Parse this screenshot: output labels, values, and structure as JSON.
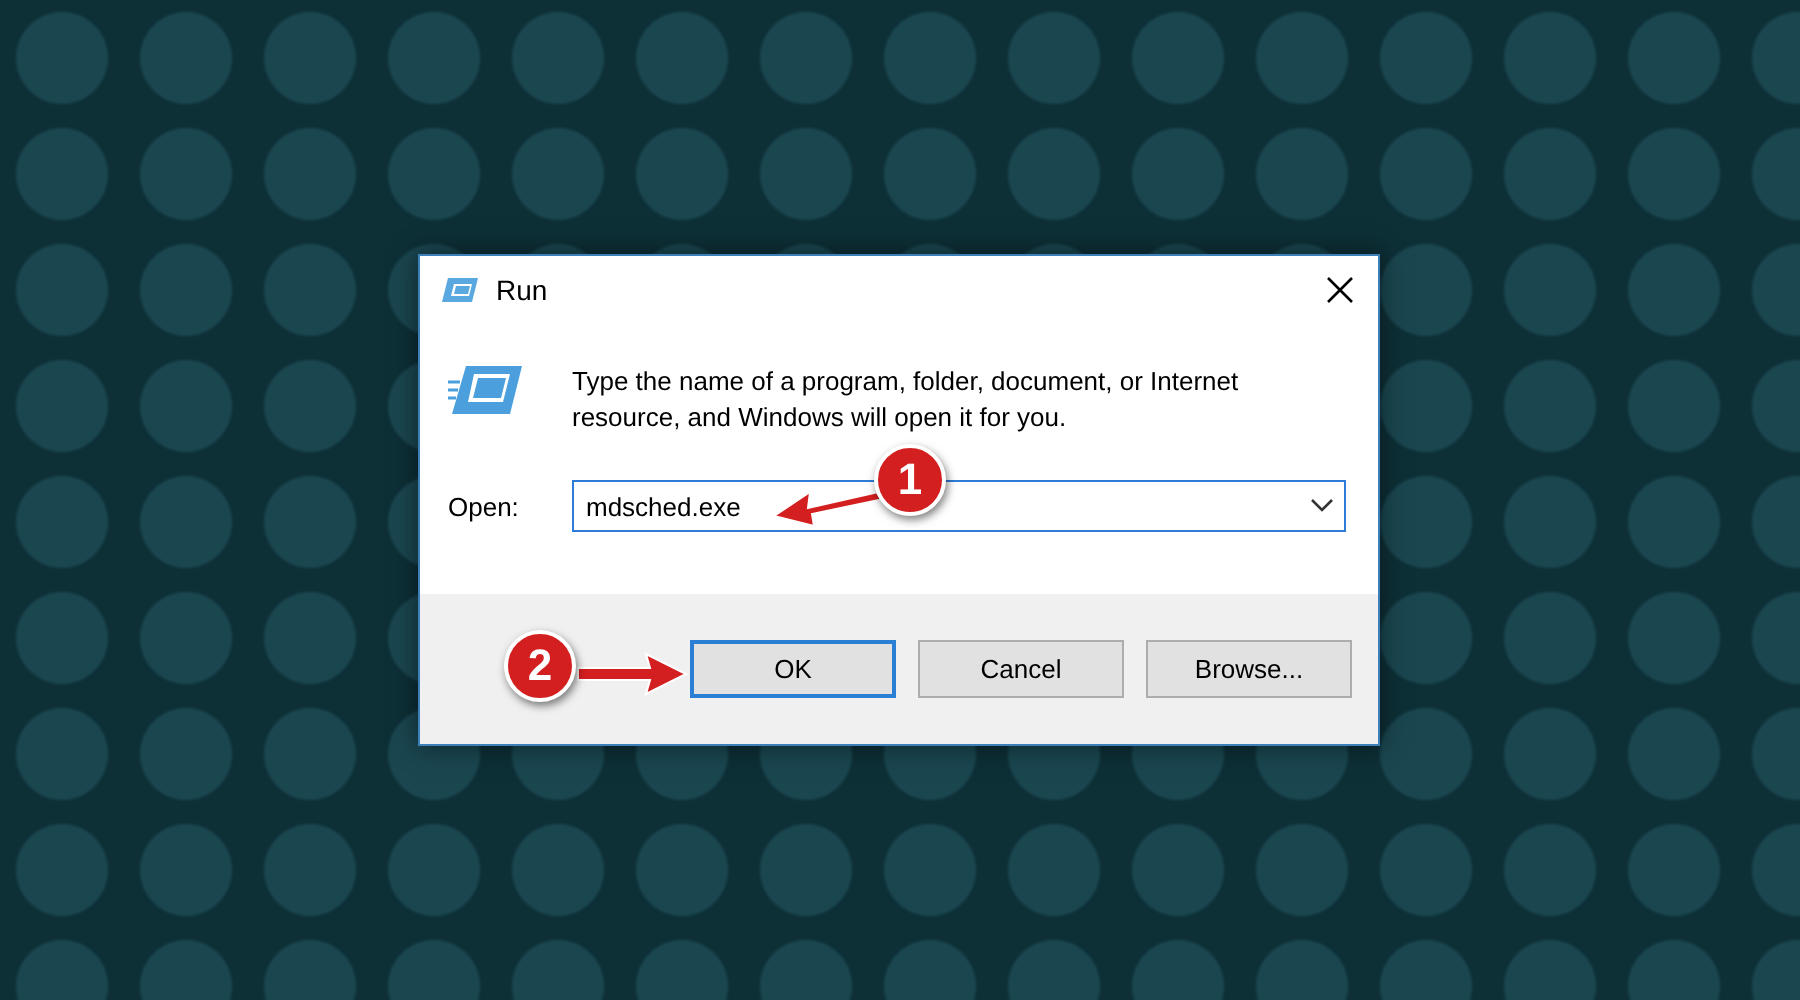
{
  "window": {
    "title": "Run"
  },
  "description": "Type the name of a program, folder, document, or Internet resource, and Windows will open it for you.",
  "open_field": {
    "label": "Open:",
    "value": "mdsched.exe"
  },
  "buttons": [
    {
      "label": "OK",
      "default": true
    },
    {
      "label": "Cancel",
      "default": false
    },
    {
      "label": "Browse...",
      "default": false
    }
  ],
  "annotations": [
    {
      "number": "1"
    },
    {
      "number": "2"
    }
  ]
}
